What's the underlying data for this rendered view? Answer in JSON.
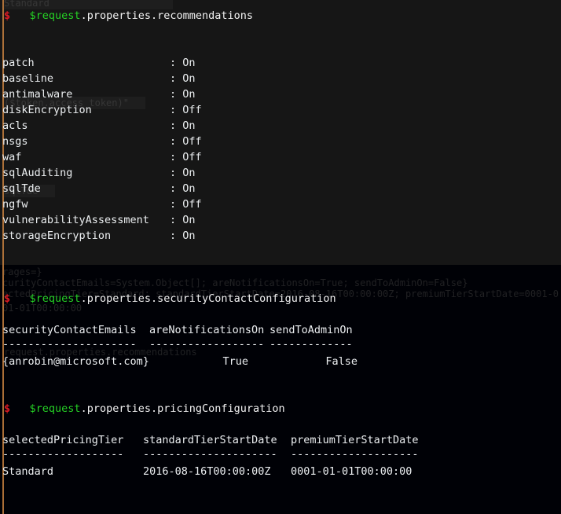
{
  "terminal": {
    "shell": "powershell",
    "prompt_symbol": "$",
    "colors": {
      "background_top": "#161616",
      "background_bottom": "#000106",
      "foreground": "#eceff1",
      "prompt_red": "#e01b24",
      "command_green": "#25d025",
      "left_edge_amber": "#c8813f",
      "ghost_text": "#4a4a4a"
    }
  },
  "ghost_scrollback": {
    "top_fragment": "Standard",
    "mid_fragment": "($token.access_token)\"",
    "mid_fragment2": "sqlTde",
    "block_a": "rages=}",
    "block_b": "curityContactEmails=System.Object[]; areNotificationsOn=True; sendToAdminOn=False}",
    "block_c": "ectedPricingTier=Standard; standardTierStartDate=2016-08-16T00:00:00Z; premiumTierStartDate=0001-0",
    "block_d": "01-01T00:00:00",
    "block_e": "request.properties.recommendations"
  },
  "blocks": [
    {
      "id": "recommendations",
      "command": {
        "prompt": "$",
        "variable": "$request",
        "rest": ".properties.recommendations"
      },
      "output_type": "key-value",
      "separator": ":",
      "rows": [
        {
          "name": "patch",
          "value": "On"
        },
        {
          "name": "baseline",
          "value": "On"
        },
        {
          "name": "antimalware",
          "value": "On"
        },
        {
          "name": "diskEncryption",
          "value": "Off"
        },
        {
          "name": "acls",
          "value": "On"
        },
        {
          "name": "nsgs",
          "value": "Off"
        },
        {
          "name": "waf",
          "value": "Off"
        },
        {
          "name": "sqlAuditing",
          "value": "On"
        },
        {
          "name": "sqlTde",
          "value": "On"
        },
        {
          "name": "ngfw",
          "value": "Off"
        },
        {
          "name": "vulnerabilityAssessment",
          "value": "On"
        },
        {
          "name": "storageEncryption",
          "value": "On"
        }
      ]
    },
    {
      "id": "securityContactConfiguration",
      "command": {
        "prompt": "$",
        "variable": "$request",
        "rest": ".properties.securityContactConfiguration"
      },
      "output_type": "table",
      "headers": [
        "securityContactEmails",
        "areNotificationsOn",
        "sendToAdminOn"
      ],
      "rules": [
        "---------------------",
        "------------------",
        "-------------"
      ],
      "rows": [
        [
          "{anrobin@microsoft.com}",
          "True",
          "False"
        ]
      ]
    },
    {
      "id": "pricingConfiguration",
      "command": {
        "prompt": "$",
        "variable": "$request",
        "rest": ".properties.pricingConfiguration"
      },
      "output_type": "table",
      "headers": [
        "selectedPricingTier",
        "standardTierStartDate",
        "premiumTierStartDate"
      ],
      "rules": [
        "-------------------",
        "---------------------",
        "--------------------"
      ],
      "rows": [
        [
          "Standard",
          "2016-08-16T00:00:00Z",
          "0001-01-01T00:00:00"
        ]
      ]
    }
  ]
}
